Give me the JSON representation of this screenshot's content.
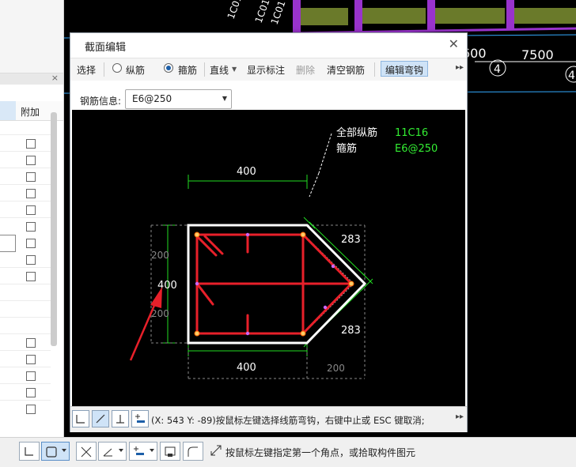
{
  "background": {
    "labels": [
      "600",
      "7500",
      "4",
      "4"
    ]
  },
  "left_panel": {
    "column_header": "附加",
    "close_glyph": "×"
  },
  "dialog": {
    "title": "截面编辑",
    "close_glyph": "✕",
    "toolbar": {
      "select": "选择",
      "longitudinal": "纵筋",
      "stirrup": "箍筋",
      "stirrup_selected": true,
      "line_mode": "直线",
      "show_annotation": "显示标注",
      "delete": "删除",
      "clear_rebar": "清空钢筋",
      "edit_hook": "编辑弯钩",
      "more": "▸▸"
    },
    "rebar_info_label": "钢筋信息:",
    "rebar_info_value": "E6@250",
    "drawing": {
      "all_long_label": "全部纵筋",
      "all_long_value": "11C16",
      "stirrup_label": "箍筋",
      "stirrup_value": "E6@250",
      "dim_top": "400",
      "dim_bottom": "400",
      "dim_left_total": "400",
      "dim_left_top": "200",
      "dim_left_bottom": "200",
      "dim_right_top": "283",
      "dim_right_bottom": "283",
      "dim_bottom_right": "200"
    },
    "status_text": "(X: 543 Y: -89)按鼠标左键选择线筋弯钩，右键中止或 ESC 键取消;",
    "status_more": "▸▸"
  },
  "bottom_bar": {
    "hint": "按鼠标左键指定第一个角点，或拾取构件图元"
  },
  "colors": {
    "rebar_red": "#e8202a",
    "text_green": "#33ee33",
    "dim_green": "#22dd22",
    "annotation_white": "#ffffff",
    "outline_white": "#ffffff",
    "arrow_red": "#e8202a",
    "accent_blue": "#cfe3f7"
  }
}
